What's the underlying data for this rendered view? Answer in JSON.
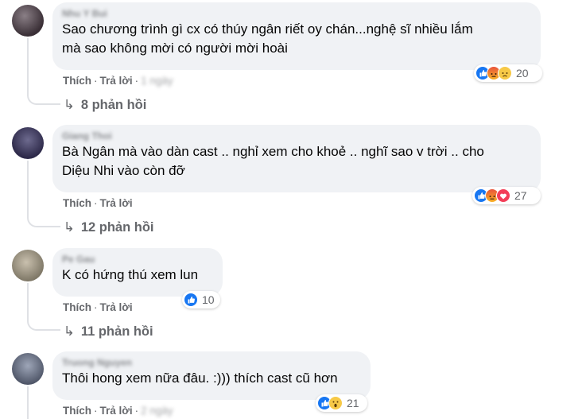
{
  "comments": [
    {
      "author": "Nhu Y Bui",
      "lines": [
        "Sao chương trình gì cx có thúy ngân riết oy chán...nghệ sĩ nhiều lắm",
        "mà sao không mời có người mời hoài"
      ],
      "like_label": "Thích",
      "reply_label": "Trả lời",
      "time": "1 ngày",
      "reactions": [
        "like",
        "angry",
        "sad"
      ],
      "reaction_count": "20",
      "replies_label": "8 phản hồi"
    },
    {
      "author": "Giang Thoi",
      "lines": [
        "Bà Ngân mà vào dàn cast .. nghỉ xem cho khoẻ .. nghĩ sao v trời .. cho",
        "Diệu Nhi vào còn đỡ"
      ],
      "like_label": "Thích",
      "reply_label": "Trả lời",
      "time": "",
      "reactions": [
        "like",
        "angry",
        "love"
      ],
      "reaction_count": "27",
      "replies_label": "12 phản hồi"
    },
    {
      "author": "Pe Gau",
      "lines": [
        "K có hứng thú xem lun"
      ],
      "like_label": "Thích",
      "reply_label": "Trả lời",
      "time": "",
      "reactions": [
        "like"
      ],
      "reaction_count": "10",
      "replies_label": "11 phản hồi"
    },
    {
      "author": "Truong Nguyen",
      "lines": [
        "Thôi hong xem nữa đâu. :))) thích cast cũ hơn"
      ],
      "like_label": "Thích",
      "reply_label": "Trả lời",
      "time": "2 ngày",
      "reactions": [
        "like",
        "wow"
      ],
      "reaction_count": "21",
      "replies_label": ""
    }
  ],
  "colors": {
    "bubble": "#f0f2f5",
    "meta_text": "#65676b",
    "like_blue": "#1877f2",
    "love_red": "#f33e58",
    "haha_yellow": "#f7c947"
  }
}
